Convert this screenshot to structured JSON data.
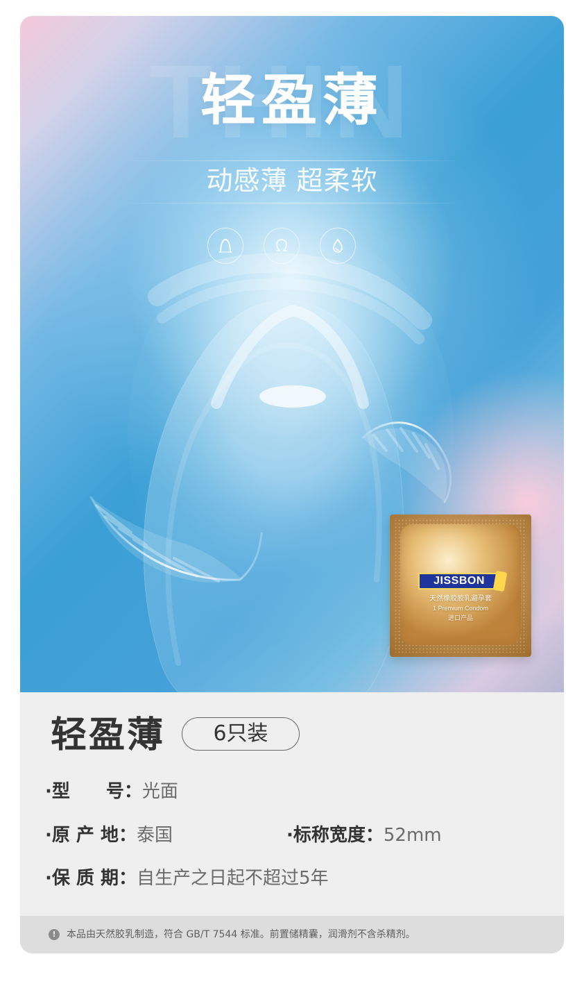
{
  "hero": {
    "watermark": "THIN",
    "title": "轻盈薄",
    "subtitle": "动感薄 超柔软",
    "icons": [
      {
        "name": "shape-icon"
      },
      {
        "name": "omega-icon"
      },
      {
        "name": "drop-icon"
      }
    ],
    "pack": {
      "brand": "JISSBON",
      "cn_text": "天然橡胶胶乳避孕套",
      "en_text": "1 Premium Condom",
      "import_text": "进口产品"
    }
  },
  "product": {
    "title": "轻盈薄",
    "badge": "6只装"
  },
  "specs": {
    "model_label": "·型　　号：",
    "model_value": "光面",
    "origin_label": "·原 产 地：",
    "origin_value": "泰国",
    "width_label": "·标称宽度：",
    "width_value": "52mm",
    "shelf_label": "·保 质 期：",
    "shelf_value": "自生产之日起不超过5年"
  },
  "notice": {
    "icon": "!",
    "text": "本品由天然胶乳制造，符合 GB/T 7544 标准。前置储精囊，润滑剂不含杀精剂。"
  }
}
